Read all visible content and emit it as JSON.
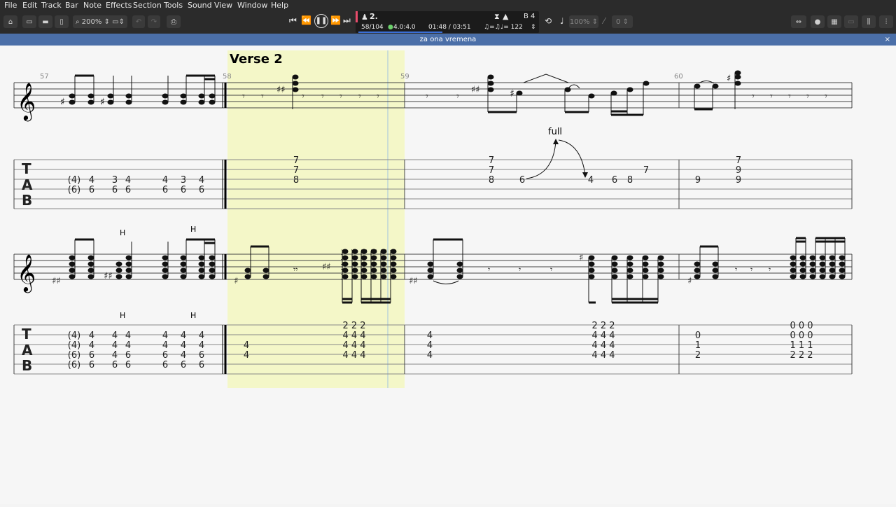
{
  "menu": [
    "File",
    "Edit",
    "Track",
    "Bar",
    "Note",
    "Effects",
    "Section",
    "Tools",
    "Sound",
    "View",
    "Window",
    "Help"
  ],
  "toolbar": {
    "zoom": "200%",
    "track_label": "2.",
    "bar_position": "58/104",
    "time_signature": "4.0:4.0",
    "time_position": "01:48 / 03:51",
    "key": "B 4",
    "tempo": "♩= 122",
    "speed": "100%",
    "pitch": "0",
    "play_icon": "pause-icon",
    "accent_color": "#e84c6b"
  },
  "document_title": "za ona vremena",
  "score": {
    "section_label": "Verse 2",
    "bar_numbers": [
      "57",
      "58",
      "59",
      "60"
    ],
    "annotation_full": "full",
    "hammer_label": "H",
    "tab_clef": [
      "T",
      "A",
      "B"
    ],
    "highlight_color": "#f4f7c8",
    "system1_tab": {
      "bar57": [
        [
          "(4)",
          "4",
          "3",
          "4",
          "4",
          "3",
          "4"
        ],
        [
          "(6)",
          "6",
          "6",
          "6",
          "6",
          "6",
          "6"
        ]
      ],
      "bar58": [
        "7",
        "7",
        "8"
      ],
      "bar59": [
        "7",
        "7",
        "8",
        "6",
        "4",
        "6",
        "8",
        "7"
      ],
      "bar60": [
        "7",
        "9",
        "9",
        "9"
      ]
    },
    "system2_tab": {
      "bar57": [
        [
          "(4)",
          "4",
          "4",
          "4",
          "4",
          "4",
          "4"
        ],
        [
          "(4)",
          "4",
          "4",
          "4",
          "4",
          "4",
          "4"
        ],
        [
          "(6)",
          "6",
          "4",
          "6",
          "6",
          "4",
          "6"
        ],
        [
          "(6)",
          "6",
          "6",
          "6",
          "6",
          "6",
          "6"
        ]
      ],
      "bar58": [
        "4",
        "4",
        "2 2 2",
        "4 4 4",
        "4 4 4",
        "4 4 4"
      ],
      "bar59": [
        "4",
        "4",
        "4",
        "2 2  2",
        "4 4  4",
        "4 4  4",
        "4 4  4"
      ],
      "bar60": [
        "0",
        "1",
        "2",
        "0 0 0",
        "0 0 0",
        "1 1 1",
        "2 2 2"
      ]
    }
  }
}
